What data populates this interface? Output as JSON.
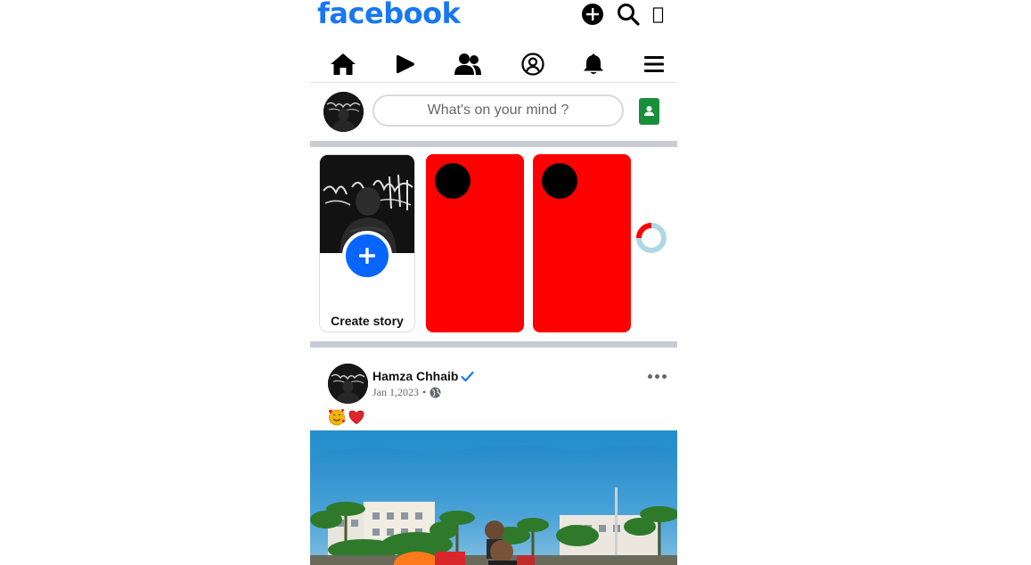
{
  "header": {
    "logo": "facebook",
    "icons": [
      "plus-circle-icon",
      "search-icon",
      "messenger-icon"
    ]
  },
  "nav": {
    "tabs": [
      {
        "name": "home",
        "icon": "home-icon"
      },
      {
        "name": "watch",
        "icon": "play-icon"
      },
      {
        "name": "friends",
        "icon": "friends-icon"
      },
      {
        "name": "profile",
        "icon": "user-circle-icon"
      },
      {
        "name": "notifications",
        "icon": "bell-icon"
      },
      {
        "name": "menu",
        "icon": "hamburger-icon"
      }
    ]
  },
  "composer": {
    "placeholder": "What's on your mind ?",
    "photo_icon": "photo-icon"
  },
  "stories": {
    "create_label": "Create story",
    "story_color": "#ff0000"
  },
  "post": {
    "author": "Hamza Chhaib",
    "verified": true,
    "date": "Jan 1,2023",
    "separator": "•",
    "audience_icon": "globe-icon",
    "text_emojis": [
      "🥰",
      "❤️"
    ]
  },
  "colors": {
    "brand": "#1877f2",
    "create_plus": "#0866ff",
    "photo_btn": "#1a8f3b",
    "divider": "#c9ccd1"
  }
}
